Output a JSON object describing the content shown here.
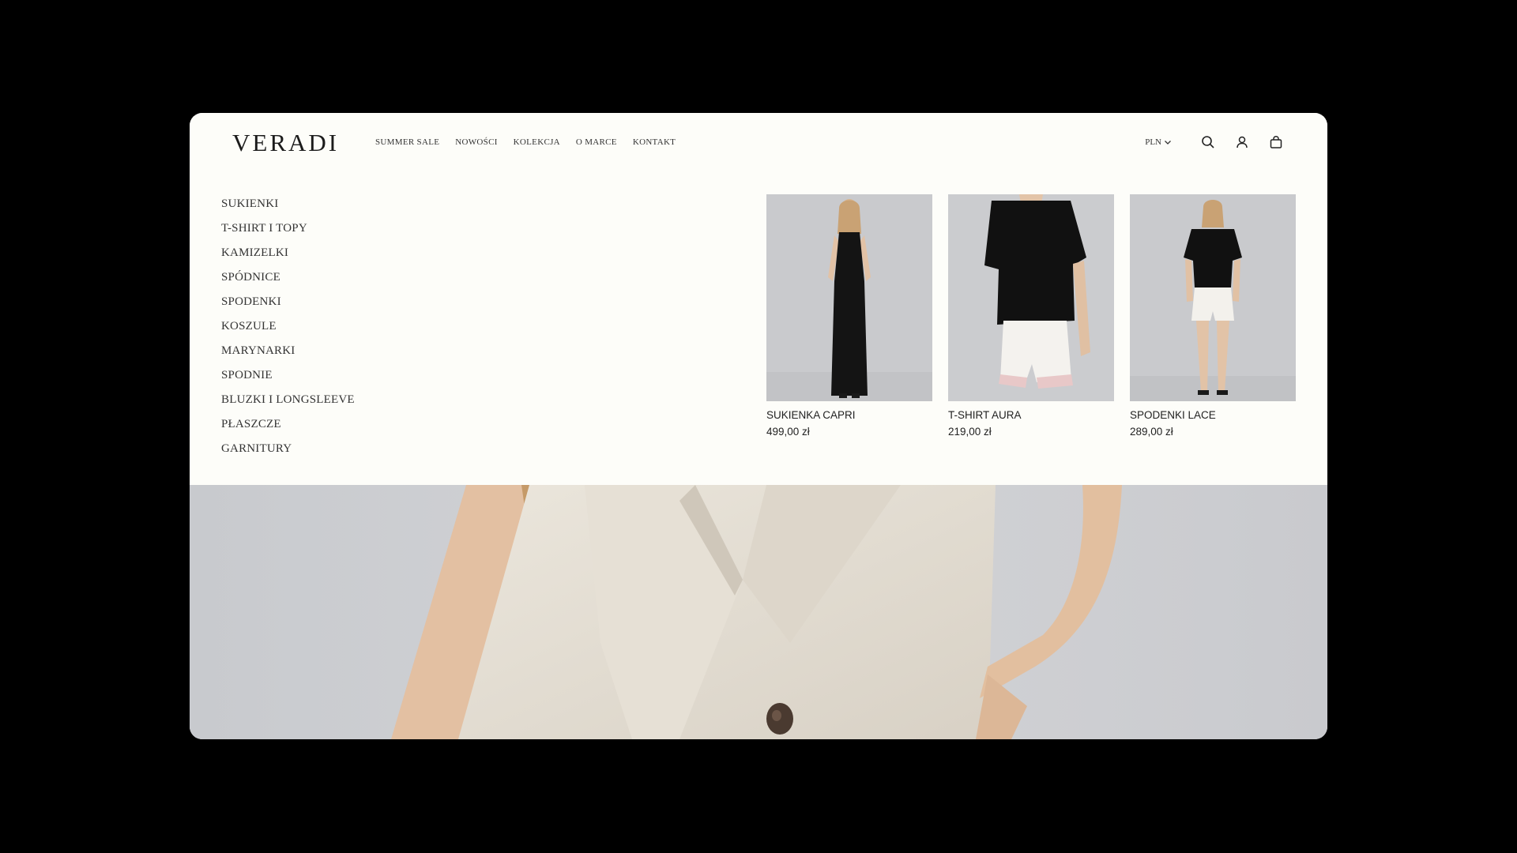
{
  "brand": {
    "logo_text": "VERADI"
  },
  "nav": {
    "items": [
      {
        "label": "SUMMER SALE"
      },
      {
        "label": "NOWOŚCI"
      },
      {
        "label": "KOLEKCJA"
      },
      {
        "label": "O MARCE"
      },
      {
        "label": "KONTAKT"
      }
    ]
  },
  "header_right": {
    "currency": "PLN",
    "icons": [
      "search-icon",
      "account-icon",
      "cart-icon"
    ]
  },
  "mega_menu": {
    "categories": [
      "SUKIENKI",
      "T-SHIRT I TOPY",
      "KAMIZELKI",
      "SPÓDNICE",
      "SPODENKI",
      "KOSZULE",
      "MARYNARKI",
      "SPODNIE",
      "BLUZKI I LONGSLEEVE",
      "PŁASZCZE",
      "GARNITURY"
    ],
    "products": [
      {
        "name": "SUKIENKA CAPRI",
        "price": "499,00 zł"
      },
      {
        "name": "T-SHIRT AURA",
        "price": "219,00 zł"
      },
      {
        "name": "SPODENKI LACE",
        "price": "289,00 zł"
      }
    ]
  },
  "colors": {
    "background": "#000000",
    "panel": "#fdfdf9",
    "text": "#333333"
  }
}
